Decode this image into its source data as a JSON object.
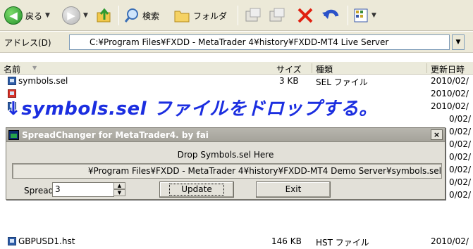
{
  "toolbar": {
    "back_label": "戻る",
    "search_label": "検索",
    "folder_label": "フォルダ"
  },
  "address": {
    "label": "アドレス(D)",
    "path": "C:¥Program Files¥FXDD - MetaTrader 4¥history¥FXDD-MT4 Live Server"
  },
  "columns": {
    "name": "名前",
    "size": "サイズ",
    "type": "種類",
    "modified": "更新日時"
  },
  "files": [
    {
      "name": "symbols.sel",
      "size": "3 KB",
      "type": "SEL ファイル",
      "date": "2010/02/"
    },
    {
      "name": "",
      "size": "",
      "type": "",
      "date": "2010/02/"
    },
    {
      "name": "",
      "size": "",
      "type": "",
      "date": "2010/02/"
    },
    {
      "name": "",
      "size": "",
      "type": "",
      "date": "0/02/"
    },
    {
      "name": "",
      "size": "",
      "type": "",
      "date": "0/02/"
    },
    {
      "name": "",
      "size": "",
      "type": "",
      "date": "0/02/"
    },
    {
      "name": "",
      "size": "",
      "type": "",
      "date": "0/02/"
    },
    {
      "name": "",
      "size": "",
      "type": "",
      "date": "0/02/"
    },
    {
      "name": "",
      "size": "",
      "type": "",
      "date": "0/02/"
    },
    {
      "name": "",
      "size": "",
      "type": "",
      "date": "0/02/"
    },
    {
      "name": "GBPUSD1.hst",
      "size": "146 KB",
      "type": "HST ファイル",
      "date": "2010/02/"
    }
  ],
  "annotation": {
    "text": "↓symbols.sel ファイルをドロップする。"
  },
  "dialog": {
    "title": "SpreadChanger for MetaTrader4.   by fai",
    "close": "×",
    "drop_label": "Drop  Symbols.sel  Here",
    "path": "¥Program Files¥FXDD - MetaTrader 4¥history¥FXDD-MT4 Demo Server¥symbols.sel",
    "spread_label": "Spread",
    "spread_value": "3",
    "update_label": "Update",
    "exit_label": "Exit"
  },
  "colors": {
    "annotation": "#1b2ee0",
    "dialog_title_bg": "#a5a39a",
    "toolbar_bg": "#ece9d8"
  }
}
